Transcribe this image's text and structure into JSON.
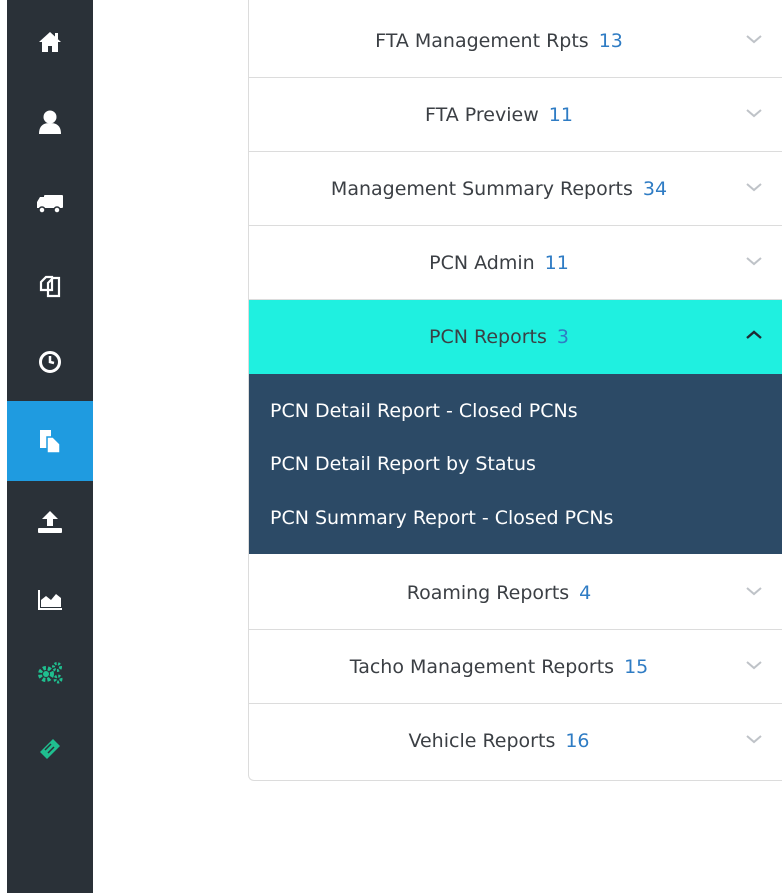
{
  "sidebar": {
    "items": [
      {
        "icon": "home-icon"
      },
      {
        "icon": "user-icon"
      },
      {
        "icon": "truck-icon"
      },
      {
        "icon": "copy-documents-icon"
      },
      {
        "icon": "clock-icon"
      },
      {
        "icon": "reports-icon",
        "active": true
      },
      {
        "icon": "upload-icon"
      },
      {
        "icon": "area-chart-icon"
      },
      {
        "icon": "cogs-icon"
      },
      {
        "icon": "ticket-icon"
      }
    ],
    "colors": {
      "background": "#2a3138",
      "active": "#1f9be0",
      "accent_green": "#1fbf8f"
    }
  },
  "reports": [
    {
      "label": "FTA Management Rpts",
      "count": "13"
    },
    {
      "label": "FTA Preview",
      "count": "11"
    },
    {
      "label": "Management Summary Reports",
      "count": "34"
    },
    {
      "label": "PCN Admin",
      "count": "11"
    },
    {
      "label": "PCN Reports",
      "count": "3",
      "expanded": true,
      "items": [
        "PCN Detail Report - Closed PCNs",
        "PCN Detail Report by Status",
        "PCN Summary Report - Closed PCNs"
      ]
    },
    {
      "label": "Roaming Reports",
      "count": "4"
    },
    {
      "label": "Tacho Management Reports",
      "count": "15"
    },
    {
      "label": "Vehicle Reports",
      "count": "16"
    }
  ],
  "colors": {
    "active_header": "#1ff0e0",
    "submenu_bg": "#2c4a66",
    "count_text": "#2f7cc4"
  }
}
